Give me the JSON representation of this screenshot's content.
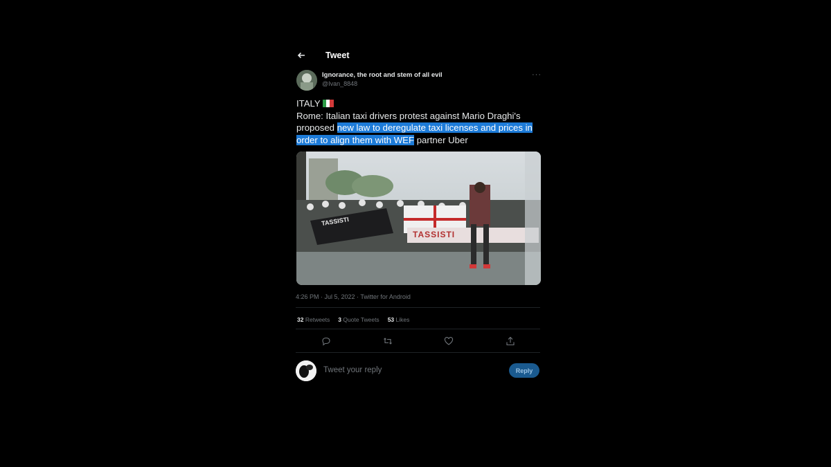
{
  "header": {
    "title": "Tweet"
  },
  "tweet": {
    "display_name": "Ignorance, the root and stem of all evil",
    "handle": "@Ivan_8848",
    "text_line1": "ITALY",
    "text_plain_1": "Rome: Italian taxi drivers protest against Mario Draghi's proposed ",
    "text_highlighted": "new law to deregulate taxi licenses and prices in order to align them with WEF",
    "text_plain_2": " partner Uber",
    "timestamp": "4:26 PM · Jul 5, 2022 · Twitter for Android",
    "media_banner_left": "TASSISTI",
    "media_banner_right": "TASSISTI"
  },
  "stats": {
    "retweets_count": "32",
    "retweets_label": "Retweets",
    "quotes_count": "3",
    "quotes_label": "Quote Tweets",
    "likes_count": "53",
    "likes_label": "Likes"
  },
  "reply": {
    "placeholder": "Tweet your reply",
    "button_label": "Reply"
  },
  "icons": {
    "back": "arrow-left-icon",
    "more": "more-icon",
    "reply": "comment-icon",
    "retweet": "retweet-icon",
    "like": "heart-icon",
    "share": "share-icon"
  },
  "colors": {
    "highlight": "#1d7bd8",
    "reply_button": "#1a5a8f"
  }
}
